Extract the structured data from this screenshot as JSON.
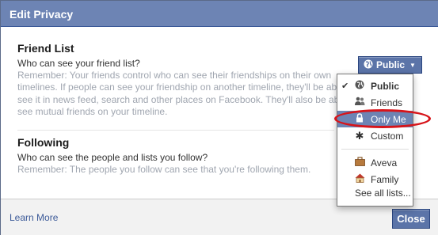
{
  "dialog": {
    "title": "Edit Privacy"
  },
  "friend_list": {
    "heading": "Friend List",
    "question": "Who can see your friend list?",
    "remember": "Remember: Your friends control who can see their friendships on their own timelines. If people can see your friendship on another timeline, they'll be able to see it in news feed, search and other places on Facebook. They'll also be able to see mutual friends on your timeline."
  },
  "following": {
    "heading": "Following",
    "question": "Who can see the people and lists you follow?",
    "remember": "Remember: The people you follow can see that you're following them."
  },
  "privacy_selector": {
    "current_label": "Public"
  },
  "menu": {
    "items": [
      {
        "label": "Public",
        "icon": "globe-icon",
        "checked": true
      },
      {
        "label": "Friends",
        "icon": "friends-icon"
      },
      {
        "label": "Only Me",
        "icon": "lock-icon",
        "selected": true
      },
      {
        "label": "Custom",
        "icon": "gear-icon"
      }
    ],
    "lists": [
      {
        "label": "Aveva",
        "icon": "briefcase-icon"
      },
      {
        "label": "Family",
        "icon": "house-icon"
      }
    ],
    "see_all": "See all lists..."
  },
  "footer": {
    "learn_more": "Learn More",
    "close": "Close"
  },
  "colors": {
    "header": "#6d84b4",
    "button": "#5b74a8",
    "highlight": "#d7141a"
  }
}
